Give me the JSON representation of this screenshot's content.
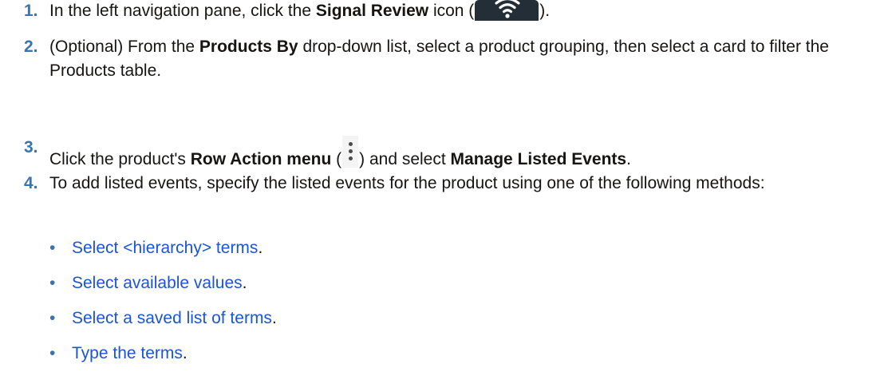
{
  "steps": [
    {
      "number": "1.",
      "text_before": "In the left navigation pane, click the ",
      "bold": "Signal Review",
      "text_after_bold": " icon (",
      "icon": "wifi-signal-icon",
      "text_end": ")."
    },
    {
      "number": "2.",
      "text_before": "(Optional) From the ",
      "bold": "Products By",
      "text_after": " drop-down list, select a product grouping, then select a card to filter the Products table."
    },
    {
      "number": "3.",
      "text_before": "Click the product's ",
      "bold": "Row Action menu",
      "text_after_bold": " (",
      "icon": "kebab-menu-icon",
      "text_middle": ") and select ",
      "bold2": "Manage Listed Events",
      "text_end": "."
    },
    {
      "number": "4.",
      "text": "To add listed events, specify the listed events for the product using one of the following methods:",
      "methods": [
        "Select <hierarchy> terms",
        "Select available values",
        "Select a saved list of terms",
        "Type the terms"
      ],
      "method_suffix": "."
    }
  ],
  "colors": {
    "step_number": "#3a73ad",
    "link": "#1a55d6",
    "text": "#161513",
    "icon_background": "#232e36"
  }
}
